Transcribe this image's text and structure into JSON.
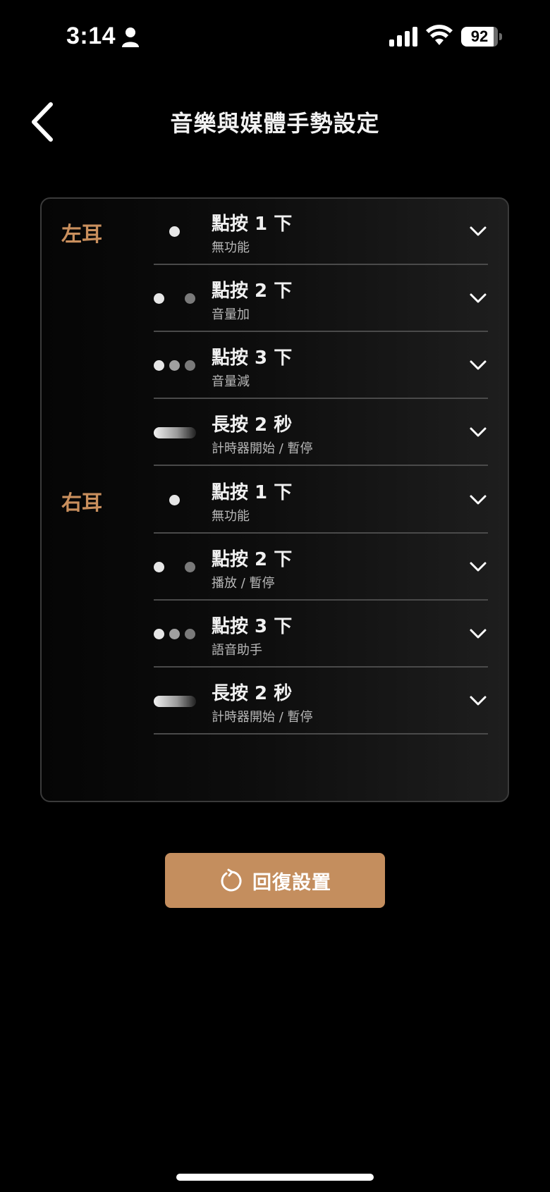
{
  "status_bar": {
    "time": "3:14",
    "battery": "92"
  },
  "header": {
    "title": "音樂與媒體手勢設定"
  },
  "left_ear": {
    "label": "左耳",
    "gestures": [
      {
        "icon": "single-tap-icon",
        "title": "點按 1 下",
        "action": "無功能"
      },
      {
        "icon": "double-tap-icon",
        "title": "點按 2 下",
        "action": "音量加"
      },
      {
        "icon": "triple-tap-icon",
        "title": "點按 3 下",
        "action": "音量減"
      },
      {
        "icon": "long-press-icon",
        "title": "長按 2 秒",
        "action": "計時器開始 / 暫停"
      }
    ]
  },
  "right_ear": {
    "label": "右耳",
    "gestures": [
      {
        "icon": "single-tap-icon",
        "title": "點按 1 下",
        "action": "無功能"
      },
      {
        "icon": "double-tap-icon",
        "title": "點按 2 下",
        "action": "播放 / 暫停"
      },
      {
        "icon": "triple-tap-icon",
        "title": "點按 3 下",
        "action": "語音助手"
      },
      {
        "icon": "long-press-icon",
        "title": "長按 2 秒",
        "action": "計時器開始 / 暫停"
      }
    ]
  },
  "reset_button": {
    "label": "回復設置",
    "icon": "reset-icon"
  },
  "colors": {
    "accent": "#c48e5e",
    "ear_label": "#c98f5d",
    "background": "#000000"
  }
}
